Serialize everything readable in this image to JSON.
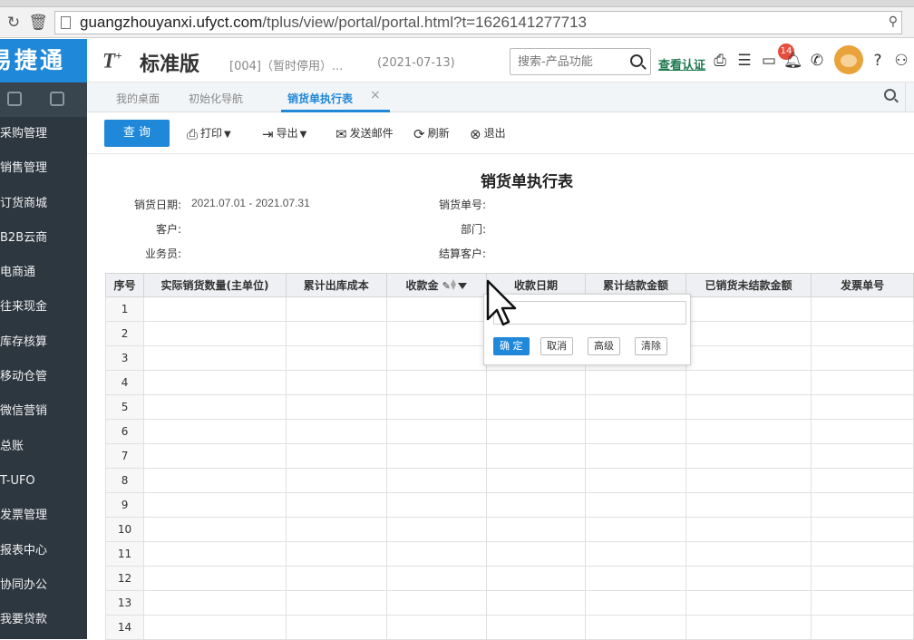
{
  "browser": {
    "url_host": "guangzhouyanxi.ufyct.com",
    "url_path": "/tplus/view/portal/portal.html?t=1626141277713",
    "reload_icon": "reload-icon",
    "home_icon": "trash-icon"
  },
  "sidebar": {
    "logo": "易捷通",
    "items": [
      {
        "label": "采购管理"
      },
      {
        "label": "销售管理"
      },
      {
        "label": "订货商城"
      },
      {
        "label": "B2B云商"
      },
      {
        "label": "电商通"
      },
      {
        "label": "往来现金"
      },
      {
        "label": "库存核算"
      },
      {
        "label": "移动仓管"
      },
      {
        "label": "微信营销"
      },
      {
        "label": "总账"
      },
      {
        "label": "T-UFO"
      },
      {
        "label": "发票管理"
      },
      {
        "label": "报表中心"
      },
      {
        "label": "协同办公"
      },
      {
        "label": "我要贷款"
      }
    ]
  },
  "header": {
    "brand_t": "T",
    "brand_plus": "+",
    "brand_name": "标准版",
    "account": "[004]（暂时停用）...",
    "account_date": "(2021-07-13)",
    "search_placeholder": "搜索-产品功能",
    "verify_link": "查看认证",
    "badge_count": "14"
  },
  "tabs": [
    {
      "label": "我的桌面"
    },
    {
      "label": "初始化导航"
    },
    {
      "label": "销货单执行表"
    }
  ],
  "toolbar": {
    "query": "查 询",
    "print": "打印",
    "export": "导出",
    "email": "发送邮件",
    "refresh": "刷新",
    "exit": "退出"
  },
  "report": {
    "title": "销货单执行表",
    "fields": {
      "sale_date_label": "销货日期:",
      "sale_date_value": "2021.07.01 - 2021.07.31",
      "customer_label": "客户:",
      "salesman_label": "业务员:",
      "order_no_label": "销货单号:",
      "dept_label": "部门:",
      "settle_customer_label": "结算客户:"
    },
    "columns": [
      "序号",
      "实际销货数量(主单位)",
      "累计出库成本",
      "收款金",
      "收款日期",
      "累计结款金额",
      "已销货未结款金额",
      "发票单号"
    ],
    "rows": [
      "1",
      "2",
      "3",
      "4",
      "5",
      "6",
      "7",
      "8",
      "9",
      "10",
      "11",
      "12",
      "13",
      "14"
    ]
  },
  "filter_popup": {
    "value": "",
    "ok": "确 定",
    "cancel": "取消",
    "advanced": "高级",
    "clear": "清除"
  }
}
